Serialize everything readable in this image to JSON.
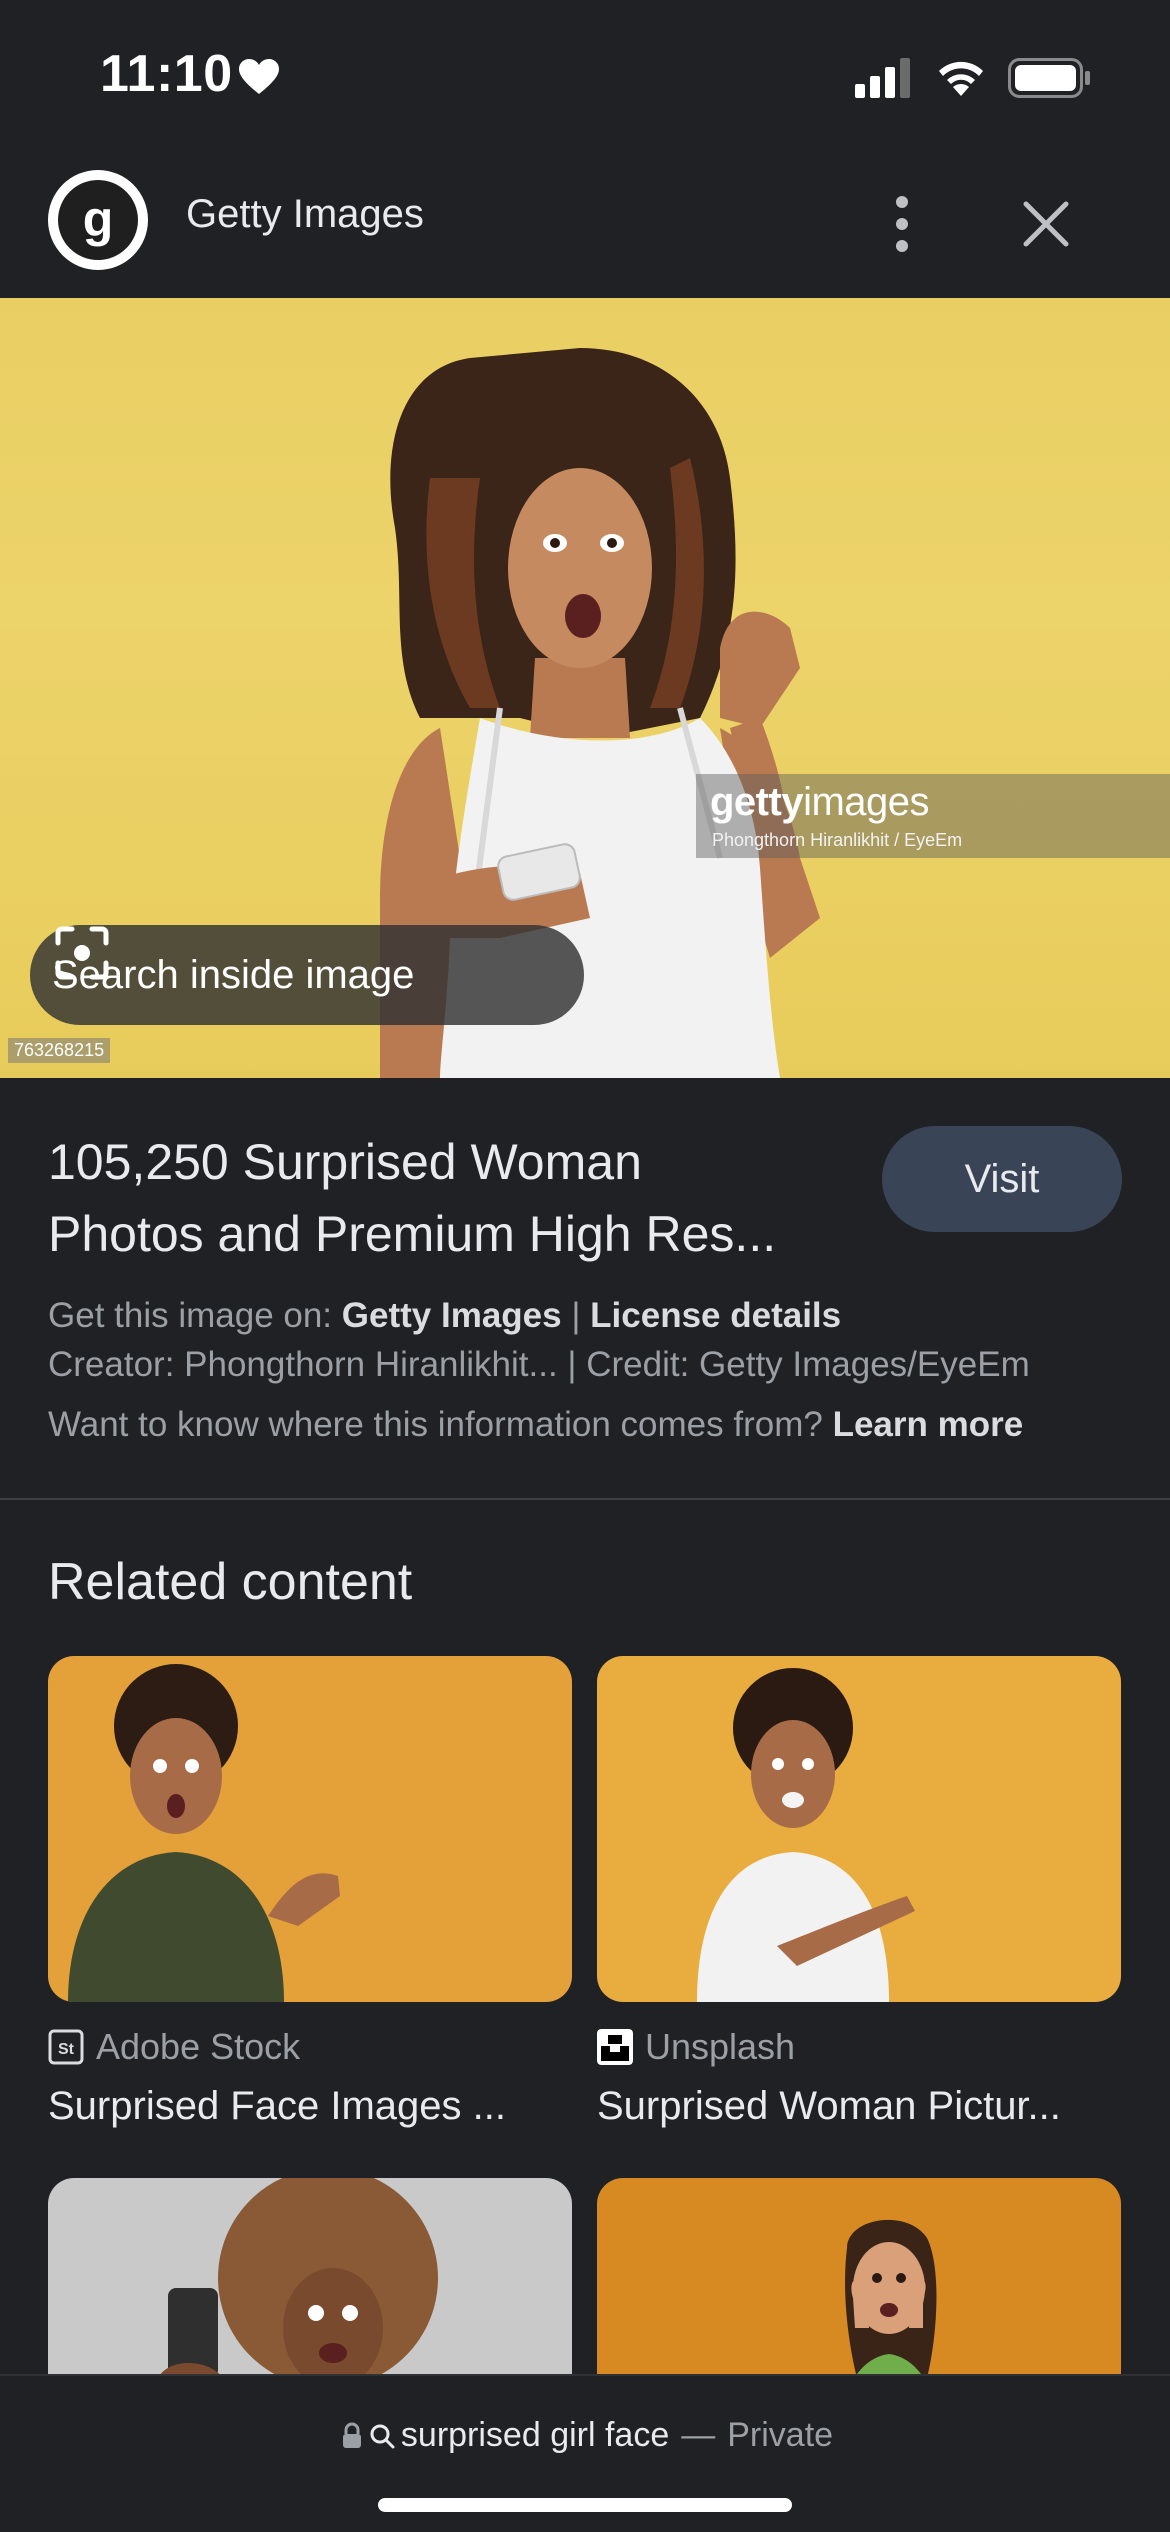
{
  "status_bar": {
    "time": "11:10",
    "icons": [
      "heart-icon",
      "cellular-signal-icon",
      "wifi-icon",
      "battery-icon"
    ]
  },
  "header": {
    "site_name": "Getty Images",
    "logo_letter": "g",
    "more_icon": "more-vertical-icon",
    "close_icon": "close-icon"
  },
  "hero": {
    "watermark_brand_bold": "getty",
    "watermark_brand_light": "images",
    "watermark_credit": "Phongthorn Hiranlikhit / EyeEm",
    "search_inside_label": "Search inside image",
    "image_id": "763268215",
    "background_color": "#e9cf63"
  },
  "result": {
    "title_line1": "105,250 Surprised Woman",
    "title_line2": "Photos and Premium High Res...",
    "visit_label": "Visit",
    "get_image_prefix": "Get this image on:",
    "get_image_source": "Getty Images",
    "separator": "|",
    "license_label": "License details",
    "creator": "Creator: Phongthorn Hiranlikhit...",
    "credit": "| Credit: Getty Images/EyeEm",
    "info_question": "Want to know where this information comes from?",
    "learn_more": "Learn more"
  },
  "related": {
    "heading": "Related content",
    "items": [
      {
        "source": "Adobe Stock",
        "source_icon": "adobe-stock-icon",
        "title": "Surprised Face Images ..."
      },
      {
        "source": "Unsplash",
        "source_icon": "unsplash-icon",
        "title": "Surprised Woman Pictur..."
      },
      {
        "source": "",
        "source_icon": "",
        "title": ""
      },
      {
        "source": "",
        "source_icon": "",
        "title": ""
      }
    ]
  },
  "bottom_bar": {
    "query": "surprised girl face",
    "separator": "—",
    "mode": "Private",
    "icons": [
      "lock-icon",
      "search-icon"
    ]
  }
}
